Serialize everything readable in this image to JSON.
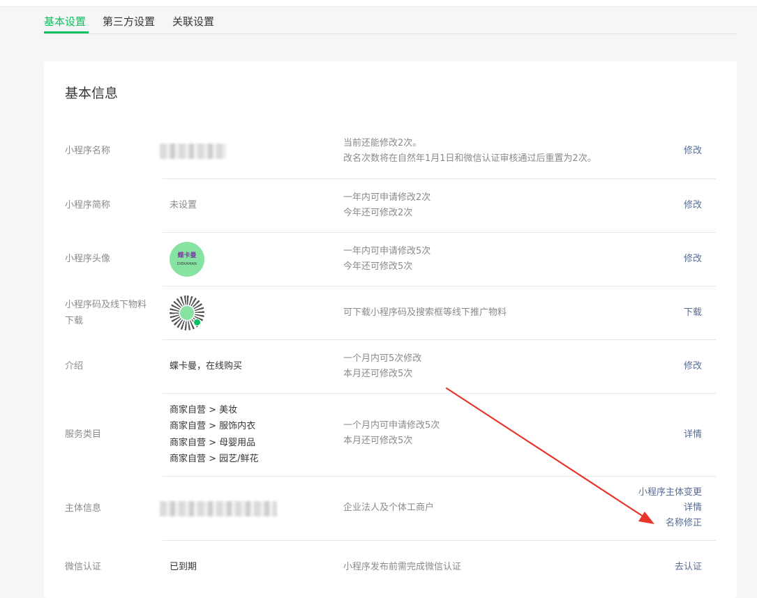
{
  "tabs": [
    {
      "label": "基本设置",
      "active": true
    },
    {
      "label": "第三方设置",
      "active": false
    },
    {
      "label": "关联设置",
      "active": false
    }
  ],
  "card": {
    "title": "基本信息",
    "rows": {
      "name": {
        "label": "小程序名称",
        "value_redacted": true,
        "desc": [
          "当前还能修改2次。",
          "改名次数将在自然年1月1日和微信认证审核通过后重置为2次。"
        ],
        "action": "修改"
      },
      "short": {
        "label": "小程序简称",
        "value": "未设置",
        "desc": [
          "一年内可申请修改2次",
          "今年还可修改2次"
        ],
        "action": "修改"
      },
      "avatar": {
        "label": "小程序头像",
        "logo_text": "蝶卡曼",
        "logo_sub": "DIEKAMAN",
        "desc": [
          "一年内可申请修改5次",
          "今年还可修改5次"
        ],
        "action": "修改"
      },
      "qrcode": {
        "label": [
          "小程序码及线下物料",
          "下载"
        ],
        "desc": "可下载小程序码及搜索框等线下推广物料",
        "action": "下载"
      },
      "intro": {
        "label": "介绍",
        "value": "蝶卡曼，在线购买",
        "desc": [
          "一个月内可5次修改",
          "本月还可修改5次"
        ],
        "action": "修改"
      },
      "category": {
        "label": "服务类目",
        "values": [
          "商家自营 > 美妆",
          "商家自营 > 服饰内衣",
          "商家自营 > 母婴用品",
          "商家自营 > 园艺/鲜花"
        ],
        "desc": [
          "一个月内可申请修改5次",
          "本月还可修改5次"
        ],
        "action": "详情"
      },
      "entity": {
        "label": "主体信息",
        "value_redacted": true,
        "desc": "企业法人及个体工商户",
        "actions": [
          "小程序主体变更",
          "详情",
          "名称修正"
        ]
      },
      "wechat": {
        "label": "微信认证",
        "value": "已到期",
        "desc": "小程序发布前需完成微信认证",
        "action": "去认证"
      }
    }
  },
  "colors": {
    "accent": "#07c160",
    "link": "#576b95",
    "annotation_arrow": "#e8342a"
  }
}
